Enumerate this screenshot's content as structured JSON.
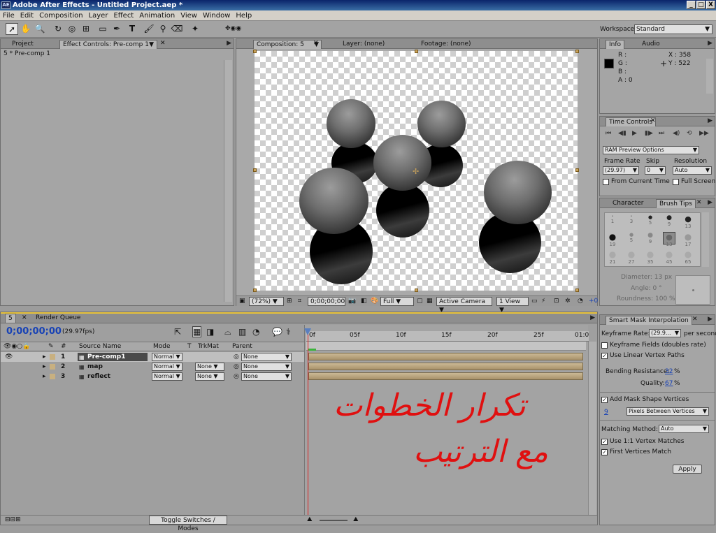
{
  "window": {
    "title": "Adobe After Effects - Untitled Project.aep *",
    "logo": "AE",
    "min": "_",
    "max": "□",
    "close": "X"
  },
  "menu": [
    "File",
    "Edit",
    "Composition",
    "Layer",
    "Effect",
    "Animation",
    "View",
    "Window",
    "Help"
  ],
  "workspace": {
    "label": "Workspace:",
    "value": "Standard"
  },
  "left_panel": {
    "tabs": [
      "Project",
      "Effect Controls: Pre-comp 1"
    ],
    "breadcrumb": "5 * Pre-comp 1"
  },
  "comp_panel": {
    "tabs": [
      "Composition: 5",
      "Layer: (none)",
      "Footage: (none)"
    ],
    "zoom": "(72%)",
    "timecode": "0;00;00;00",
    "resolution": "Full",
    "camera": "Active Camera",
    "view": "1 View",
    "offset": "+0"
  },
  "info_panel": {
    "tabs": [
      "Info",
      "Audio"
    ],
    "r": "R :",
    "g": "G :",
    "b": "B :",
    "a": "A : 0",
    "x": "X : 358",
    "y": "Y : 522"
  },
  "time_controls": {
    "title": "Time Controls",
    "ram_preview": "RAM Preview Options",
    "frame_rate_label": "Frame Rate",
    "skip_label": "Skip",
    "resolution_label": "Resolution",
    "frame_rate": "(29.97)",
    "skip": "0",
    "resolution": "Auto",
    "from_current": "From Current Time",
    "full_screen": "Full Screen"
  },
  "brush_tips": {
    "tabs": [
      "Character",
      "Brush Tips"
    ],
    "sizes": [
      "1",
      "3",
      "5",
      "9",
      "13",
      "19",
      "5",
      "9",
      "13",
      "17",
      "21",
      "27",
      "35",
      "45",
      "65"
    ],
    "diameter": "Diameter: 13 px",
    "angle": "Angle: 0 °",
    "roundness": "Roundness: 100 %"
  },
  "timeline": {
    "tabs": [
      "5",
      "Render Queue"
    ],
    "timecode": "0;00;00;00",
    "fps": "(29.97fps)",
    "columns": [
      "#",
      "Source Name",
      "Mode",
      "T",
      "TrkMat",
      "Parent"
    ],
    "ruler": [
      "0f",
      "05f",
      "10f",
      "15f",
      "20f",
      "25f",
      "01:0"
    ],
    "layers": [
      {
        "num": "1",
        "name": "Pre-comp1",
        "mode": "Normal",
        "trkmat": "",
        "parent": "None"
      },
      {
        "num": "2",
        "name": "map",
        "mode": "Normal",
        "trkmat": "None",
        "parent": "None"
      },
      {
        "num": "3",
        "name": "reflect",
        "mode": "Normal",
        "trkmat": "None",
        "parent": "None"
      }
    ],
    "toggle": "Toggle Switches / Modes"
  },
  "handwriting": {
    "line1": "تكرار الخطوات",
    "line2": "مع الترتيب"
  },
  "smart_mask": {
    "title": "Smart Mask Interpolation",
    "keyframe_rate_label": "Keyframe Rate:",
    "keyframe_rate": "(29.9...",
    "per_second": "per second",
    "keyframe_fields": "Keyframe Fields (doubles rate)",
    "linear_vertex": "Use Linear Vertex Paths",
    "bending_label": "Bending Resistance:",
    "bending": "32",
    "quality_label": "Quality:",
    "quality": "67",
    "percent": "%",
    "add_mask": "Add Mask Shape Vertices",
    "vertices_num": "9",
    "vertices_mode": "Pixels Between Vertices",
    "matching_label": "Matching Method:",
    "matching": "Auto",
    "one_to_one": "Use 1:1 Vertex Matches",
    "first_vertices": "First Vertices Match",
    "apply": "Apply"
  },
  "colors": {
    "title_bg": "#0a246a",
    "selected_link": "#1842b5",
    "handwriting": "#e01010",
    "current_time": "#e02020"
  }
}
